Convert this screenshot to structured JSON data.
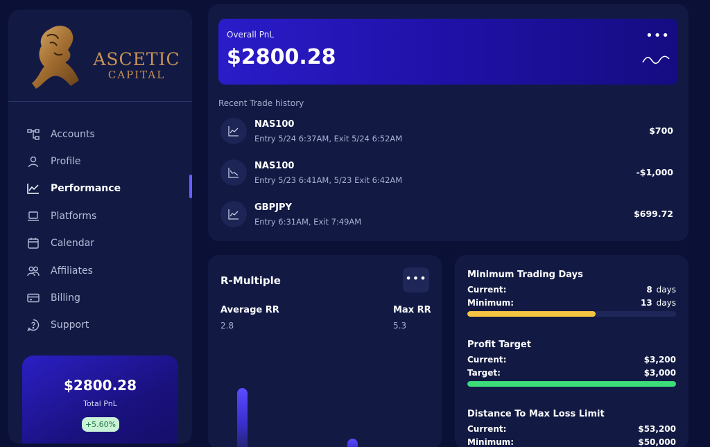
{
  "brand": {
    "line1": "ASCETIC",
    "line2": "CAPITAL"
  },
  "nav": [
    {
      "label": "Accounts",
      "icon": "hierarchy-icon",
      "active": false
    },
    {
      "label": "Profile",
      "icon": "user-icon",
      "active": false
    },
    {
      "label": "Performance",
      "icon": "line-chart-icon",
      "active": true
    },
    {
      "label": "Platforms",
      "icon": "laptop-icon",
      "active": false
    },
    {
      "label": "Calendar",
      "icon": "calendar-icon",
      "active": false
    },
    {
      "label": "Affiliates",
      "icon": "users-icon",
      "active": false
    },
    {
      "label": "Billing",
      "icon": "credit-card-icon",
      "active": false
    },
    {
      "label": "Support",
      "icon": "help-icon",
      "active": false
    }
  ],
  "sidebar_pnl": {
    "amount": "$2800.28",
    "label": "Total PnL",
    "change": "+5.60%"
  },
  "overall": {
    "label": "Overall PnL",
    "amount": "$2800.28"
  },
  "recent": {
    "title": "Recent Trade history",
    "trades": [
      {
        "symbol": "NAS100",
        "detail": "Entry 5/24 6:37AM, Exit 5/24 6:52AM",
        "value": "$700",
        "trend": "up"
      },
      {
        "symbol": "NAS100",
        "detail": "Entry 5/23 6:41AM, 5/23 Exit 6:42AM",
        "value": "-$1,000",
        "trend": "down"
      },
      {
        "symbol": "GBPJPY",
        "detail": "Entry 6:31AM, Exit 7:49AM",
        "value": "$699.72",
        "trend": "up"
      }
    ]
  },
  "r_multiple": {
    "title": "R-Multiple",
    "avg_label": "Average RR",
    "avg_value": "2.8",
    "max_label": "Max RR",
    "max_value": "5.3"
  },
  "objectives": [
    {
      "name": "Minimum Trading Days",
      "k1": "Current:",
      "v1": "8",
      "k2": "Minimum:",
      "v2": "13",
      "unit": "days",
      "progress": 0.615,
      "color": "#f5c542"
    },
    {
      "name": "Profit Target",
      "k1": "Current:",
      "v1": "$3,200",
      "k2": "Target:",
      "v2": "$3,000",
      "unit": "",
      "progress": 1.0,
      "color": "#3ddc7b"
    },
    {
      "name": "Distance To Max Loss Limit",
      "k1": "Current:",
      "v1": "$53,200",
      "k2": "Minimum:",
      "v2": "$50,000",
      "unit": "",
      "progress": null,
      "color": "#3ddc7b"
    }
  ],
  "colors": {
    "background": "#0b1036",
    "panel": "#121a44",
    "accent": "#6b5cff",
    "brand_gold": "#c89353",
    "positive_badge": "#c9f2d6"
  }
}
